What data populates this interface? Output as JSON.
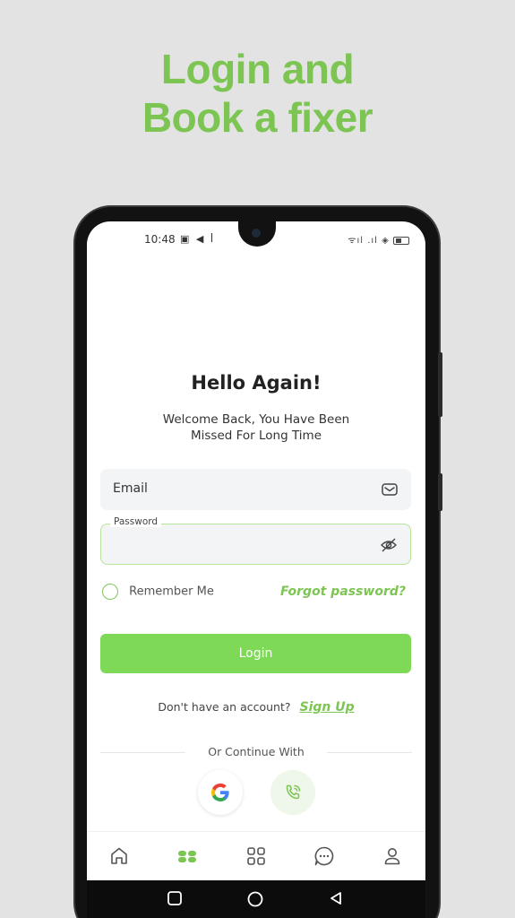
{
  "promo": {
    "headline_line1": "Login and",
    "headline_line2": "Book a fixer"
  },
  "status_bar": {
    "time": "10:48",
    "left_icons": "▣ ◀ ꟾ",
    "right_icons": "ᯤıl .ıl ◈"
  },
  "login": {
    "title": "Hello Again!",
    "subtitle_line1": "Welcome Back, You Have Been",
    "subtitle_line2": "Missed For Long Time",
    "email_placeholder": "Email",
    "password_label": "Password",
    "remember_label": "Remember Me",
    "forgot_label": "Forgot password?",
    "login_button": "Login",
    "no_account_text": "Don't have an account?",
    "signup_label": "Sign Up",
    "continue_with": "Or Continue With"
  },
  "tabs": [
    {
      "icon": "home-icon",
      "active": false
    },
    {
      "icon": "fixers-icon",
      "active": true
    },
    {
      "icon": "grid-icon",
      "active": false
    },
    {
      "icon": "chat-icon",
      "active": false
    },
    {
      "icon": "profile-icon",
      "active": false
    }
  ],
  "colors": {
    "accent": "#7dc552",
    "button": "#7ed957",
    "background": "#e3e3e3"
  }
}
